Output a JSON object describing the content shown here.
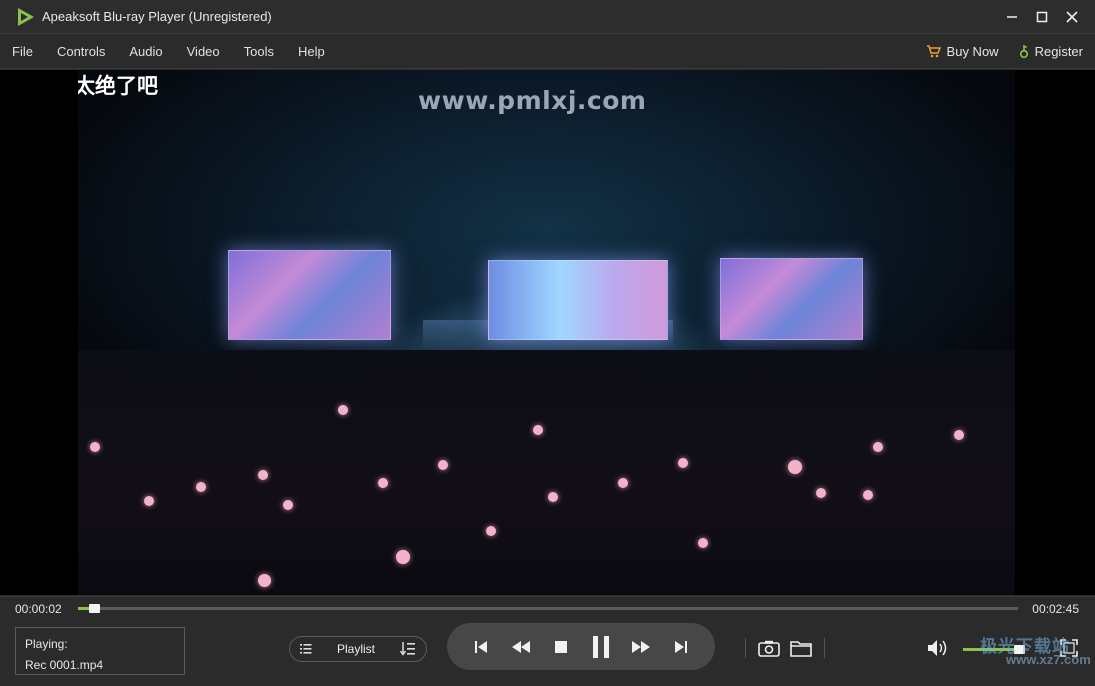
{
  "window": {
    "title": "Apeaksoft Blu-ray Player (Unregistered)",
    "minimize_icon": "minimize-icon",
    "maximize_icon": "maximize-icon",
    "close_icon": "close-icon"
  },
  "menu": {
    "items": [
      "File",
      "Controls",
      "Audio",
      "Video",
      "Tools",
      "Help"
    ],
    "buy_now": "Buy Now",
    "register": "Register"
  },
  "video": {
    "watermark": "www.pmlxj.com",
    "subtitle": "太绝了吧"
  },
  "progress": {
    "current_time": "00:00:02",
    "total_time": "00:02:45",
    "fraction": 0.012
  },
  "now_playing": {
    "label": "Playing:",
    "file": "Rec 0001.mp4"
  },
  "playlist": {
    "label": "Playlist"
  },
  "volume": {
    "fraction": 0.85
  },
  "site_watermark": {
    "line1": "极光下载站",
    "line2": "www.xz7.com"
  },
  "colors": {
    "accent": "#8bc34a",
    "background": "#2b2b2b",
    "transport_bg": "#474747"
  }
}
